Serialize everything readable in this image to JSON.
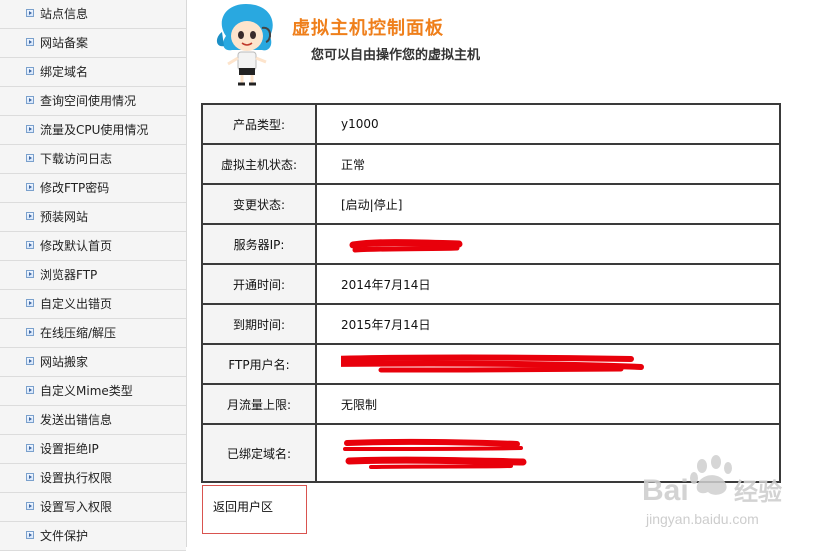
{
  "sidebar": {
    "items": [
      {
        "label": "站点信息"
      },
      {
        "label": "网站备案"
      },
      {
        "label": "绑定域名"
      },
      {
        "label": "查询空间使用情况"
      },
      {
        "label": "流量及CPU使用情况"
      },
      {
        "label": "下载访问日志"
      },
      {
        "label": "修改FTP密码"
      },
      {
        "label": "预装网站"
      },
      {
        "label": "修改默认首页"
      },
      {
        "label": "浏览器FTP"
      },
      {
        "label": "自定义出错页"
      },
      {
        "label": "在线压缩/解压"
      },
      {
        "label": "网站搬家"
      },
      {
        "label": "自定义Mime类型"
      },
      {
        "label": "发送出错信息"
      },
      {
        "label": "设置拒绝IP"
      },
      {
        "label": "设置执行权限"
      },
      {
        "label": "设置写入权限"
      },
      {
        "label": "文件保护"
      }
    ]
  },
  "header": {
    "title": "虚拟主机控制面板",
    "subtitle": "您可以自由操作您的虚拟主机"
  },
  "info": {
    "product_type_label": "产品类型:",
    "product_type_value": "y1000",
    "host_status_label": "虚拟主机状态:",
    "host_status_value": "正常",
    "change_status_label": "变更状态:",
    "change_status_value": "[启动|停止]",
    "server_ip_label": "服务器IP:",
    "open_time_label": "开通时间:",
    "open_time_value": "2014年7月14日",
    "expire_time_label": "到期时间:",
    "expire_time_value": "2015年7月14日",
    "ftp_user_label": "FTP用户名:",
    "monthly_traffic_label": "月流量上限:",
    "monthly_traffic_value": "无限制",
    "bound_domains_label": "已绑定域名:"
  },
  "back": {
    "label": "返回用户区"
  },
  "watermark": {
    "brand": "Baidu经验",
    "url": "jingyan.baidu.com"
  },
  "colors": {
    "title": "#ef7f1b",
    "redaction": "#e8000b",
    "border": "#3a3a3a"
  }
}
